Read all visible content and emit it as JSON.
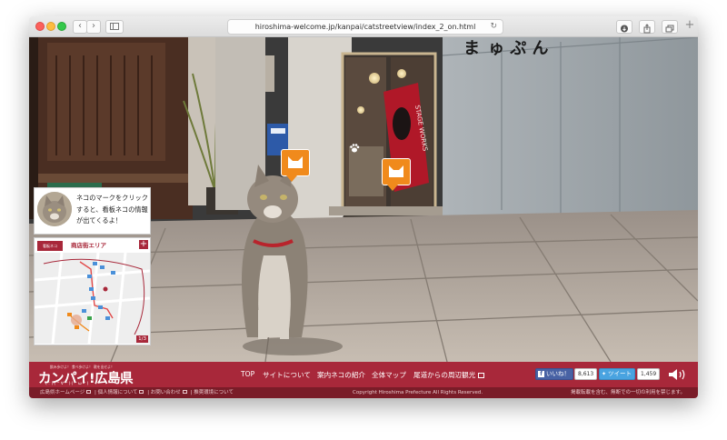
{
  "browser": {
    "url": "hiroshima-welcome.jp/kanpai/catstreetview/index_2_on.html",
    "back_icon": "chevron-left-icon",
    "forward_icon": "chevron-right-icon"
  },
  "scene": {
    "sign_text": "ま",
    "poster_text": "STAGE WORKS"
  },
  "info": {
    "text": "ネコのマークをクリックすると、看板ネコの情報が出てくるよ！"
  },
  "minimap": {
    "logo_label": "看板ネコ",
    "title": "商店街エリア",
    "page": "1/3",
    "expand_label": "+"
  },
  "footer": {
    "brand_tagline": "飲み歩けよ！ 食べ歩けよ！ 歌を出せよ！",
    "brand_name": "カンパイ!広島県",
    "brand_sub": "(∵)(^∀^)(^ω^)",
    "nav": [
      "TOP",
      "サイトについて",
      "案内ネコの紹介",
      "全体マップ",
      "尾道からの周辺観光"
    ],
    "facebook_label": "いいね！",
    "facebook_count": "8,613",
    "twitter_label": "ツイート",
    "twitter_count": "1,459"
  },
  "subfooter": {
    "links": [
      "広島県ホームページ",
      "個人情報について",
      "お問い合わせ",
      "推奨環境について"
    ],
    "separator": "|",
    "copyright": "Copyright Hiroshima Prefecture All Rights Reserved.",
    "notice": "掲載転載を含む、無断での一切の利用を禁じます。"
  },
  "colors": {
    "brand_red": "#a8283a",
    "marker_orange": "#f08a1c"
  }
}
